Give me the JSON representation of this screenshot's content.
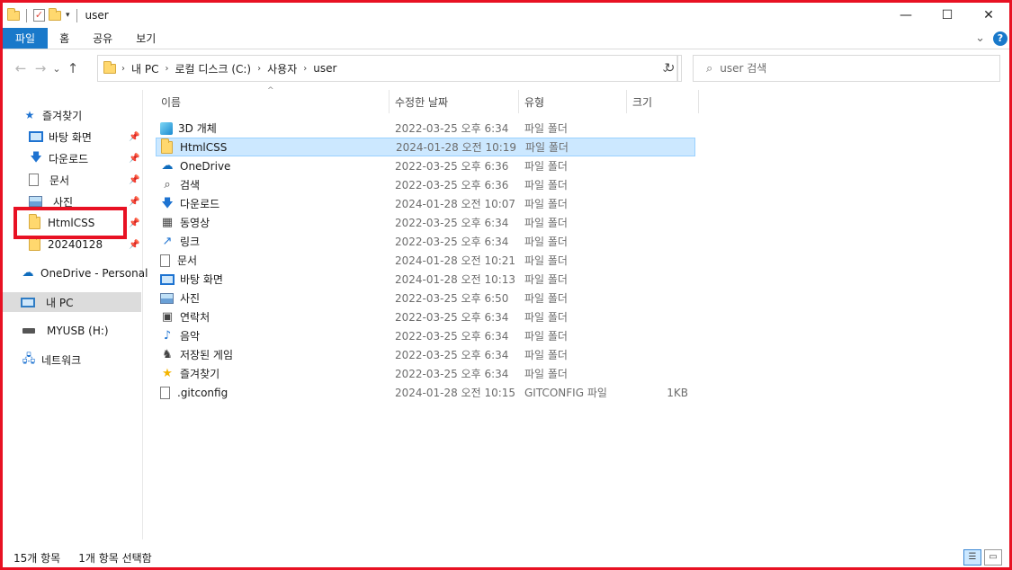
{
  "window": {
    "title": "user",
    "minimize": "—",
    "maximize": "☐",
    "close": "✕"
  },
  "ribbon": {
    "tabs": [
      "파일",
      "홈",
      "공유",
      "보기"
    ],
    "expand": "⌄",
    "help": "?"
  },
  "nav": {
    "back": "←",
    "forward": "→",
    "recent": "⌄",
    "up": "↑"
  },
  "address": {
    "crumbs": [
      "내 PC",
      "로컬 디스크 (C:)",
      "사용자",
      "user"
    ],
    "separator": "›",
    "dropdown": "⌄",
    "refresh": "↻"
  },
  "search": {
    "placeholder": "user 검색"
  },
  "sidebar": {
    "quick_access": "즐겨찾기",
    "items": [
      {
        "label": "바탕 화면",
        "icon": "desktop-icon",
        "pinned": true
      },
      {
        "label": "다운로드",
        "icon": "download-icon",
        "pinned": true
      },
      {
        "label": "문서",
        "icon": "documents-icon",
        "pinned": true
      },
      {
        "label": "사진",
        "icon": "pictures-icon",
        "pinned": true
      },
      {
        "label": "HtmlCSS",
        "icon": "folder-icon",
        "pinned": true
      },
      {
        "label": "20240128",
        "icon": "folder-icon",
        "pinned": true
      }
    ],
    "onedrive": "OneDrive - Personal",
    "this_pc": "내 PC",
    "usb": "MYUSB (H:)",
    "network": "네트워크"
  },
  "columns": {
    "name": "이름",
    "date": "수정한 날짜",
    "type": "유형",
    "size": "크기"
  },
  "files": [
    {
      "name": "3D 개체",
      "date": "2022-03-25 오후 6:34",
      "type": "파일 폴더",
      "size": "",
      "icon": "3d-objects-icon"
    },
    {
      "name": "HtmlCSS",
      "date": "2024-01-28 오전 10:19",
      "type": "파일 폴더",
      "size": "",
      "icon": "folder-icon"
    },
    {
      "name": "OneDrive",
      "date": "2022-03-25 오후 6:36",
      "type": "파일 폴더",
      "size": "",
      "icon": "onedrive-icon"
    },
    {
      "name": "검색",
      "date": "2022-03-25 오후 6:36",
      "type": "파일 폴더",
      "size": "",
      "icon": "search-icon"
    },
    {
      "name": "다운로드",
      "date": "2024-01-28 오전 10:07",
      "type": "파일 폴더",
      "size": "",
      "icon": "download-icon"
    },
    {
      "name": "동영상",
      "date": "2022-03-25 오후 6:34",
      "type": "파일 폴더",
      "size": "",
      "icon": "videos-icon"
    },
    {
      "name": "링크",
      "date": "2022-03-25 오후 6:34",
      "type": "파일 폴더",
      "size": "",
      "icon": "links-icon"
    },
    {
      "name": "문서",
      "date": "2024-01-28 오전 10:21",
      "type": "파일 폴더",
      "size": "",
      "icon": "documents-icon"
    },
    {
      "name": "바탕 화면",
      "date": "2024-01-28 오전 10:13",
      "type": "파일 폴더",
      "size": "",
      "icon": "desktop-icon"
    },
    {
      "name": "사진",
      "date": "2022-03-25 오후 6:50",
      "type": "파일 폴더",
      "size": "",
      "icon": "pictures-icon"
    },
    {
      "name": "연락처",
      "date": "2022-03-25 오후 6:34",
      "type": "파일 폴더",
      "size": "",
      "icon": "contacts-icon"
    },
    {
      "name": "음악",
      "date": "2022-03-25 오후 6:34",
      "type": "파일 폴더",
      "size": "",
      "icon": "music-icon"
    },
    {
      "name": "저장된 게임",
      "date": "2022-03-25 오후 6:34",
      "type": "파일 폴더",
      "size": "",
      "icon": "saved-games-icon"
    },
    {
      "name": "즐겨찾기",
      "date": "2022-03-25 오후 6:34",
      "type": "파일 폴더",
      "size": "",
      "icon": "favorites-icon"
    },
    {
      "name": ".gitconfig",
      "date": "2024-01-28 오전 10:15",
      "type": "GITCONFIG 파일",
      "size": "1KB",
      "icon": "file-icon"
    }
  ],
  "status": {
    "count": "15개 항목",
    "selection": "1개 항목 선택함"
  },
  "colors": {
    "accent": "#1979ca",
    "selection": "#cce8ff",
    "highlight_box": "#e81123"
  }
}
